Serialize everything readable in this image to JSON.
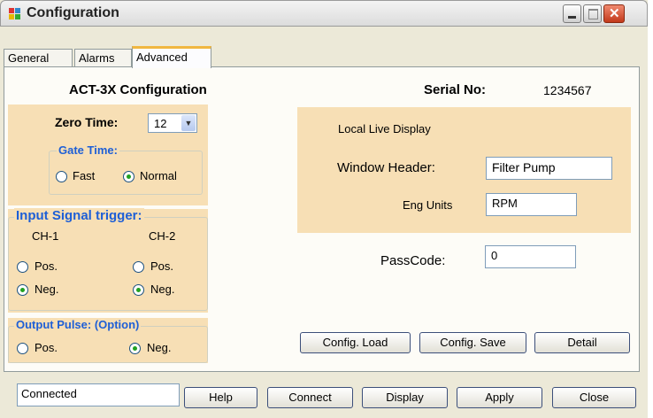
{
  "window": {
    "title": "Configuration"
  },
  "tabs": [
    "General",
    "Alarms",
    "Advanced"
  ],
  "advanced": {
    "config_title": "ACT-3X Configuration",
    "serial_label": "Serial No:",
    "serial_value": "1234567",
    "zero_time_label": "Zero Time:",
    "zero_time_value": "12",
    "gate_time": {
      "legend": "Gate Time:",
      "fast": "Fast",
      "normal": "Normal",
      "selected": "Normal"
    },
    "input_signal": {
      "legend": "Input Signal trigger:",
      "ch1": "CH-1",
      "ch2": "CH-2",
      "pos": "Pos.",
      "neg": "Neg.",
      "ch1_selected": "Neg.",
      "ch2_selected": "Neg."
    },
    "output_pulse": {
      "legend": "Output Pulse: (Option)",
      "pos": "Pos.",
      "neg": "Neg.",
      "selected": "Neg."
    },
    "live_display": {
      "heading": "Local Live Display",
      "window_header_label": "Window Header:",
      "window_header_value": "Filter Pump",
      "eng_units_label": "Eng Units",
      "eng_units_value": "RPM"
    },
    "passcode_label": "PassCode:",
    "passcode_value": "0",
    "buttons": {
      "config_load": "Config. Load",
      "config_save": "Config. Save",
      "detail": "Detail"
    }
  },
  "footer": {
    "status": "Connected",
    "buttons": {
      "help": "Help",
      "connect": "Connect",
      "display": "Display",
      "apply": "Apply",
      "close": "Close"
    }
  },
  "colors": {
    "panel_tan": "#f7dfb5",
    "legend_blue": "#1e5fd6",
    "radio_dot": "#21a121",
    "tab_accent": "#f0b740"
  },
  "icons": [
    "app-icon",
    "minimize-icon",
    "maximize-icon",
    "close-icon",
    "chevron-down-icon"
  ]
}
